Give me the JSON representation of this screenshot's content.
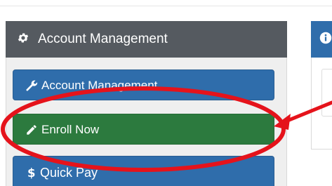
{
  "panel": {
    "title": "Account Management",
    "header_icon": "gear-icon"
  },
  "nav": {
    "items": [
      {
        "label": "Account Management",
        "icon": "wrench-icon",
        "color": "#2f6dab"
      },
      {
        "label": "Enroll Now",
        "icon": "pencil-icon",
        "color": "#2c7a3e"
      },
      {
        "label": "Quick Pay",
        "icon": "dollar-icon",
        "color": "#2f6dab"
      }
    ]
  },
  "info_panel": {
    "icon": "info-icon",
    "color": "#2f6dab"
  },
  "annotation": {
    "color": "#e5131b",
    "highlight_target": "Enroll Now"
  }
}
